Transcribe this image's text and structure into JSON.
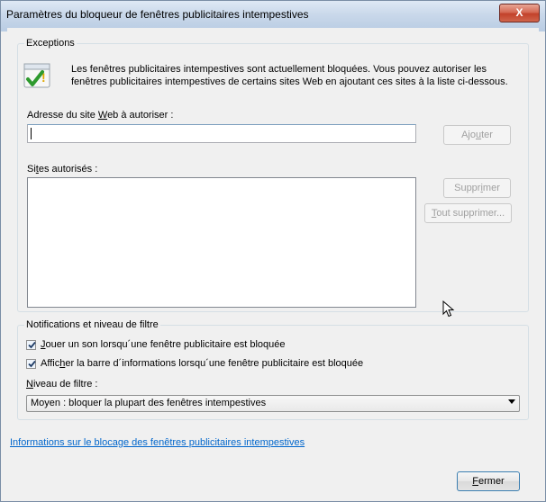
{
  "window": {
    "title": "Paramètres du bloqueur de fenêtres publicitaires intempestives",
    "close_label": "X"
  },
  "exceptions": {
    "group_label": "Exceptions",
    "info_line1": "Les fenêtres publicitaires intempestives sont actuellement bloquées.  Vous pouvez autoriser les",
    "info_line2": "fenêtres publicitaires intempestives de certains sites Web en ajoutant ces sites à la liste ci-dessous.",
    "address_label_pre": "Adresse du site ",
    "address_label_key": "W",
    "address_label_post": "eb à autoriser :",
    "address_value": "",
    "add_button_pre": "Ajo",
    "add_button_key": "u",
    "add_button_post": "ter",
    "sites_label_pre": "Si",
    "sites_label_key": "t",
    "sites_label_post": "es autorisés :",
    "sites": [],
    "remove_button_pre": "Suppr",
    "remove_button_key": "i",
    "remove_button_post": "mer",
    "remove_all_button_pre": "",
    "remove_all_button_key": "T",
    "remove_all_button_post": "out supprimer..."
  },
  "notifications": {
    "group_label": "Notifications et niveau de filtre",
    "sound_checked": true,
    "sound_label_pre": "",
    "sound_label_key": "J",
    "sound_label_post": "ouer un son lorsqu´une fenêtre publicitaire est bloquée",
    "infobar_checked": true,
    "infobar_label_pre": "Affic",
    "infobar_label_key": "h",
    "infobar_label_post": "er la barre d´informations lorsqu´une fenêtre publicitaire est bloquée",
    "filter_label_pre": "",
    "filter_label_key": "N",
    "filter_label_post": "iveau de filtre :",
    "filter_value": "Moyen : bloquer la plupart des fenêtres intempestives"
  },
  "footer": {
    "link": "Informations sur le blocage des fenêtres publicitaires intempestives",
    "close_button_pre": "",
    "close_button_key": "F",
    "close_button_post": "ermer"
  }
}
